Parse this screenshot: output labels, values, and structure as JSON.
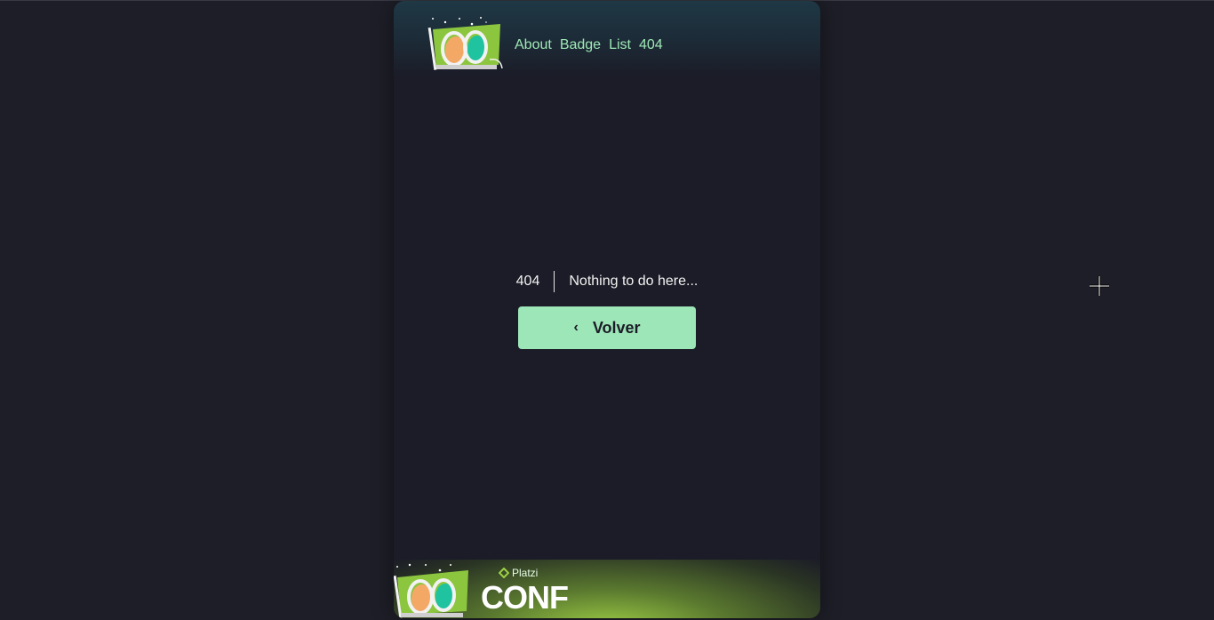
{
  "header": {
    "nav": [
      "About",
      "Badge",
      "List",
      "404"
    ]
  },
  "error": {
    "code": "404",
    "message": "Nothing to do here..."
  },
  "back_button": {
    "label": "Volver",
    "icon": "chevron-left-icon"
  },
  "footer": {
    "brand_small": "Platzi",
    "brand_large": "CONF"
  },
  "colors": {
    "page_bg": "#1e1e28",
    "card_bg": "#1b1c27",
    "nav_text": "#9fe8b6",
    "button_bg": "#9de6b8",
    "accent_green": "#9ed045"
  }
}
